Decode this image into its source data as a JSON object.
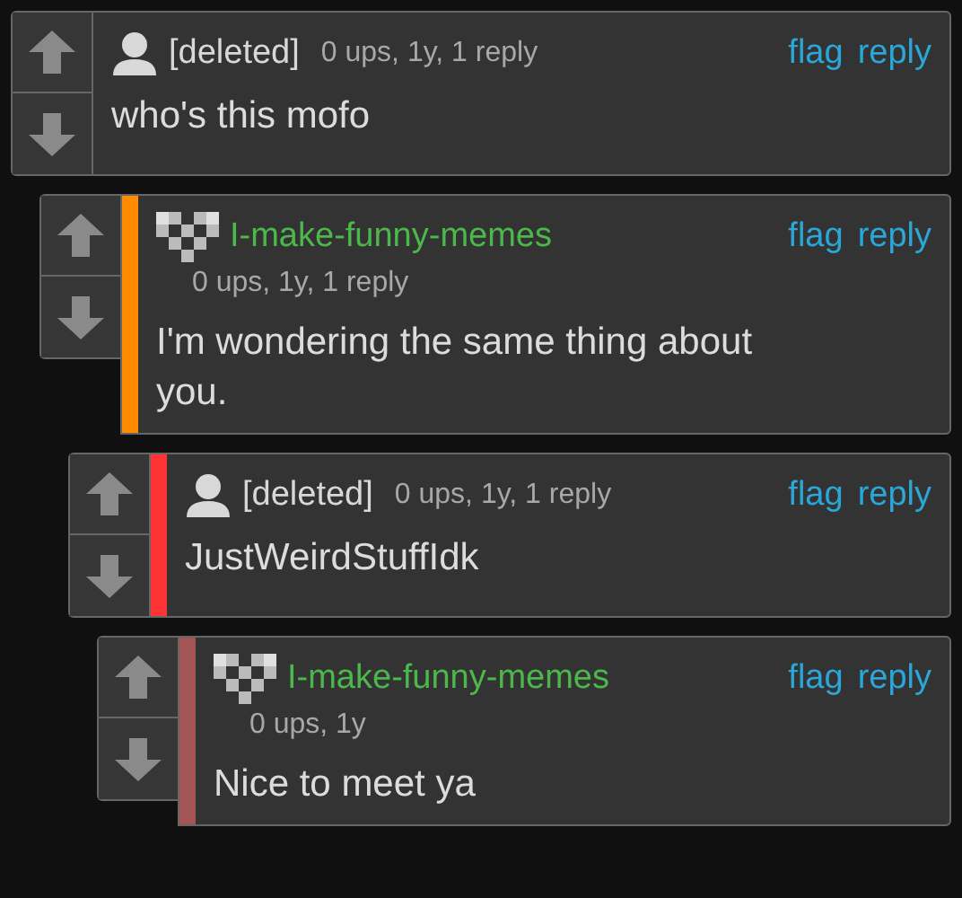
{
  "comments": [
    {
      "kind": "deleted",
      "user": "[deleted]",
      "meta": "0 ups, 1y, 1 reply",
      "actions": [
        "flag",
        "reply"
      ],
      "text": "who's this mofo",
      "children": [
        {
          "kind": "member",
          "user": "I-make-funny-memes",
          "color": "#ff8c00",
          "meta": "0 ups, 1y, 1 reply",
          "actions": [
            "flag",
            "reply"
          ],
          "text": "I'm wondering the same thing about you.",
          "children": [
            {
              "kind": "deleted",
              "user": "[deleted]",
              "color": "#ff3333",
              "meta": "0 ups, 1y, 1 reply",
              "actions": [
                "flag",
                "reply"
              ],
              "text": "JustWeirdStuffIdk",
              "children": [
                {
                  "kind": "member",
                  "user": "I-make-funny-memes",
                  "color": "#a35454",
                  "meta": "0 ups, 1y",
                  "actions": [
                    "flag",
                    "reply"
                  ],
                  "text": "Nice to meet ya"
                }
              ]
            }
          ]
        }
      ]
    }
  ]
}
